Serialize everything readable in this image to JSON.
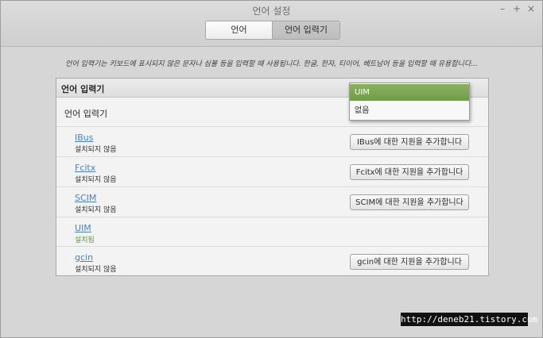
{
  "window": {
    "title": "언어 설정",
    "controls": {
      "minimize": "–",
      "maximize": "+",
      "close": "×"
    }
  },
  "tabs": [
    {
      "label": "언어",
      "selected": false
    },
    {
      "label": "언어 입력기",
      "selected": true
    }
  ],
  "description": "언어 입력기는 키보드에 표시되지 않은 문자나 심볼 등을 입력할 때 사용됩니다. 한글, 한자, 티이어, 베트남어 등을 입력할 때 유용합니다...",
  "panel": {
    "header": "언어 입력기",
    "main_row_label": "언어 입력기",
    "dropdown": {
      "selected": "UIM",
      "options": [
        "UIM",
        "없음"
      ]
    },
    "ime_rows": [
      {
        "name": "IBus",
        "status": "설치되지 않음",
        "button": "IBus에 대한 지원을 추가합니다"
      },
      {
        "name": "Fcitx",
        "status": "설치되지 않음",
        "button": "Fcitx에 대한 지원을 추가합니다"
      },
      {
        "name": "SCIM",
        "status": "설치되지 않음",
        "button": "SCIM에 대한 지원을 추가합니다"
      },
      {
        "name": "UIM",
        "status": "설치됨"
      },
      {
        "name": "gcin",
        "status": "설치되지 않음",
        "button": "gcin에 대한 지원을 추가합니다"
      }
    ]
  },
  "colors": {
    "selection_green": "#7ea652",
    "link_blue": "#4a7fc0",
    "installed_green": "#5b9a3a"
  },
  "watermark": "http://deneb21.tistory.com"
}
